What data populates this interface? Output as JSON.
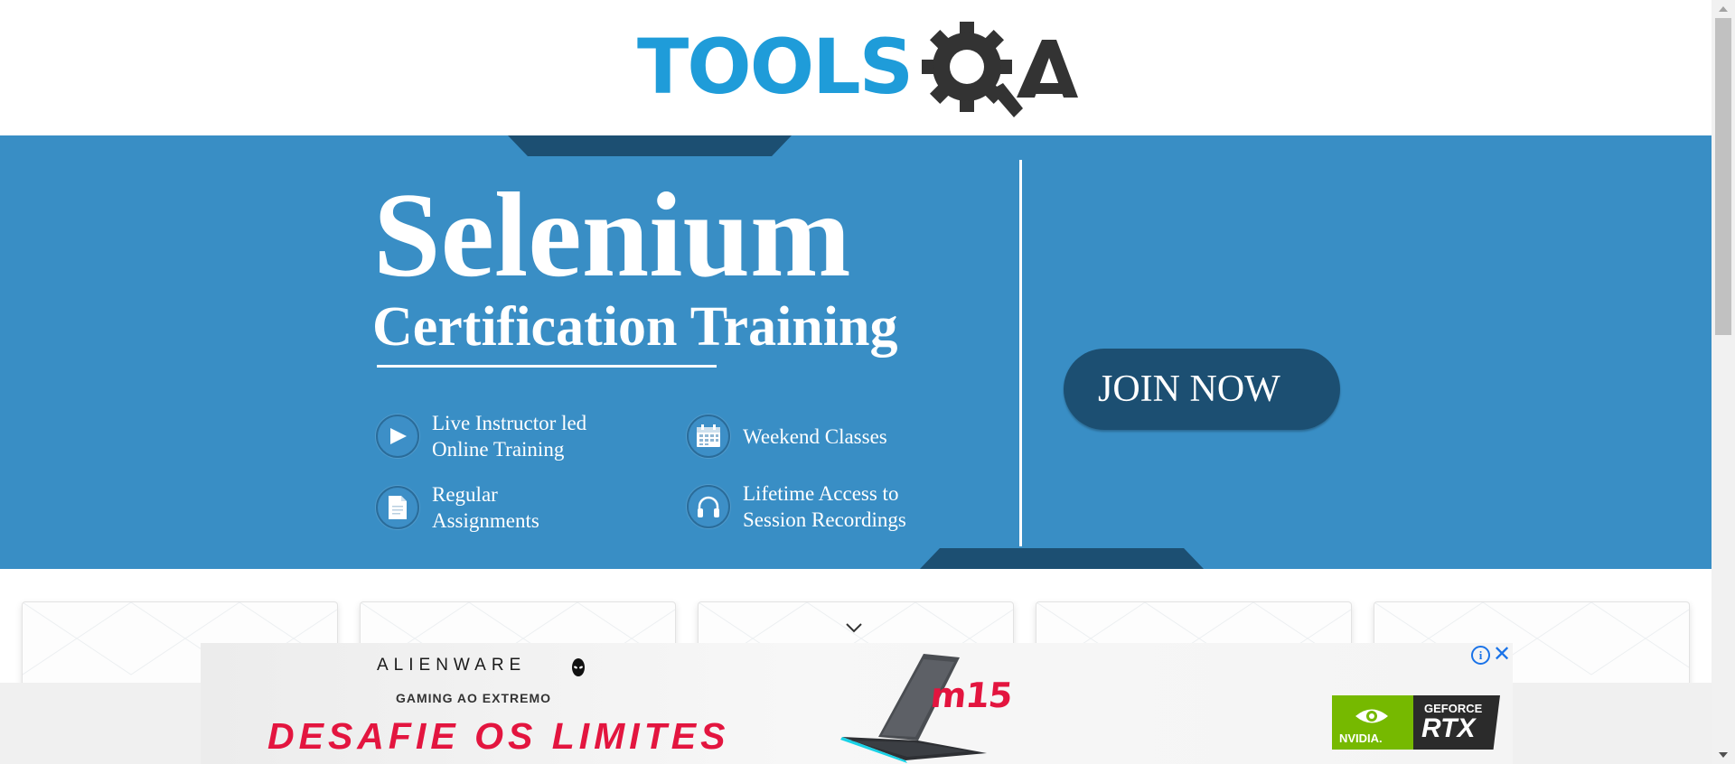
{
  "header": {
    "logo_text": "TOOLS",
    "logo_alt": "ToolsQA"
  },
  "banner": {
    "title": "Selenium",
    "subtitle": "Certification Training",
    "features": [
      {
        "icon": "play-icon",
        "text": "Live Instructor led\nOnline Training"
      },
      {
        "icon": "calendar-icon",
        "text": "Weekend Classes"
      },
      {
        "icon": "document-icon",
        "text": "Regular\nAssignments"
      },
      {
        "icon": "headphones-icon",
        "text": "Lifetime Access to\nSession Recordings"
      }
    ],
    "cta_label": "JOIN NOW"
  },
  "cards": {
    "count": 5
  },
  "ad": {
    "brand": "ALIENWARE",
    "tagline": "GAMING AO EXTREMO",
    "slogan": "DESAFIE OS LIMITES",
    "model": "m15",
    "nvidia_label": "NVIDIA.",
    "gpu_brand": "GEFORCE",
    "gpu_model": "RTX",
    "info_label": "i",
    "close_label": "✕"
  },
  "colors": {
    "banner_bg": "#398ec5",
    "banner_dark": "#1c4f72",
    "logo_blue": "#1f9cd9",
    "logo_dark": "#333333",
    "ad_red": "#e3153f",
    "nvidia_green": "#76b900"
  }
}
